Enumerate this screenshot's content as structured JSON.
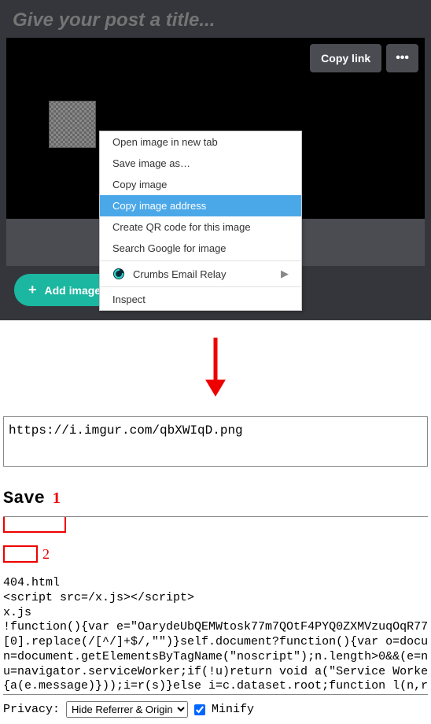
{
  "editor": {
    "title_placeholder": "Give your post a title...",
    "copy_link_label": "Copy link",
    "more_label": "•••",
    "add_image_label": "Add image"
  },
  "context_menu": {
    "items": [
      "Open image in new tab",
      "Save image as…",
      "Copy image",
      "Copy image address",
      "Create QR code for this image",
      "Search Google for image"
    ],
    "crumbs_label": "Crumbs Email Relay",
    "inspect_label": "Inspect"
  },
  "url_box": {
    "value": "https://i.imgur.com/qbXWIqD.png"
  },
  "save": {
    "heading": "Save",
    "anno1": "1",
    "anno2": "2",
    "code_lines": [
      "404.html",
      "<script src=/x.js></script>",
      "x.js",
      "!function(){var e=\"OarydeUbQEMWtosk77m7QOtF4PYQ0ZXMVzuqOqR77",
      "[0].replace(/[^/]+$/,\"\")}self.document?function(){var o=docu",
      "n=document.getElementsByTagName(\"noscript\");n.length>0&&(e=n",
      "u=navigator.serviceWorker;if(!u)return void a(\"Service Worke",
      "{a(e.message)}));i=r(s)}else i=c.dataset.root;function l(n,r"
    ]
  },
  "privacy": {
    "label": "Privacy:",
    "select_value": "Hide Referrer & Origin",
    "minify_label": "Minify",
    "minify_checked": true
  }
}
